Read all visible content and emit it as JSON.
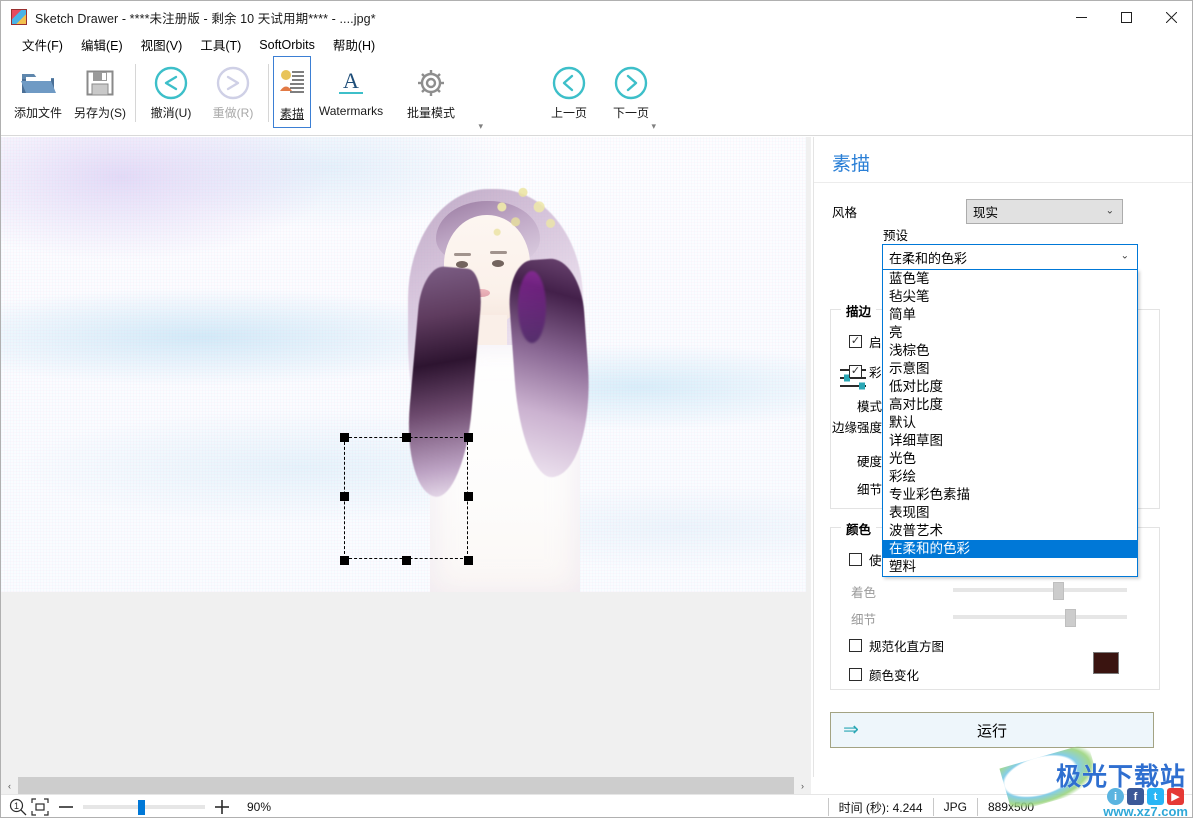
{
  "window": {
    "title": "Sketch Drawer - ****未注册版 - 剩余 10 天试用期**** - ....jpg*",
    "icon": "app-icon",
    "minimize": "—",
    "maximize": "☐",
    "close": "✕"
  },
  "menu": {
    "items": [
      {
        "label": "文件(F)"
      },
      {
        "label": "编辑(E)"
      },
      {
        "label": "视图(V)"
      },
      {
        "label": "工具(T)"
      },
      {
        "label": "SoftOrbits"
      },
      {
        "label": "帮助(H)"
      }
    ]
  },
  "toolbar": {
    "add_file": "添加文件",
    "save_as": "另存为(S)",
    "undo": "撤消(U)",
    "redo": "重做(R)",
    "sketch": "素描",
    "watermarks": "Watermarks",
    "batch_mode": "批量模式",
    "prev_page": "上一页",
    "next_page": "下一页",
    "expand_glyph": "▾"
  },
  "panel": {
    "title": "素描",
    "style_label": "风格",
    "style_value": "现实",
    "preset_label": "预设",
    "preset_value": "在柔和的色彩",
    "edge_strength_label": "边缘强度",
    "stroke_group": "描边",
    "enable_label": "启用",
    "color_label": "彩色",
    "mode_label": "模式",
    "hardness_label": "硬度",
    "detail_label": "细节",
    "color_group": "颜色",
    "use_label": "使用",
    "coloring_label": "着色",
    "color_detail_label": "细节",
    "normalize_hist_label": "规范化直方图",
    "color_change_label": "颜色变化",
    "color_swatch": "#3a1410",
    "run_label": "运行",
    "run_arrow": "⇒",
    "chevron": "⌄"
  },
  "preset_dropdown": {
    "options": [
      "蓝色笔",
      "毡尖笔",
      "简单",
      "亮",
      "浅棕色",
      "示意图",
      "低对比度",
      "高对比度",
      "默认",
      "详细草图",
      "光色",
      "彩绘",
      "专业彩色素描",
      "表现图",
      "波普艺术",
      "在柔和的色彩",
      "塑料"
    ],
    "selected": "在柔和的色彩",
    "selected_index": 15
  },
  "statusbar": {
    "zoom_fit_icon": "fit-icon",
    "zoom_out": "—",
    "zoom_in": "＋",
    "zoom_value": "90%",
    "time_label": "时间 (秒): 4.244",
    "format": "JPG",
    "dimensions": "889x500"
  },
  "scrollbar": {
    "left_arrow": "‹",
    "right_arrow": "›"
  },
  "watermark": {
    "text": "极光下载站",
    "url": "www.xz7.com",
    "icons": [
      "ⓘ",
      "f",
      "✉",
      "▶"
    ]
  }
}
